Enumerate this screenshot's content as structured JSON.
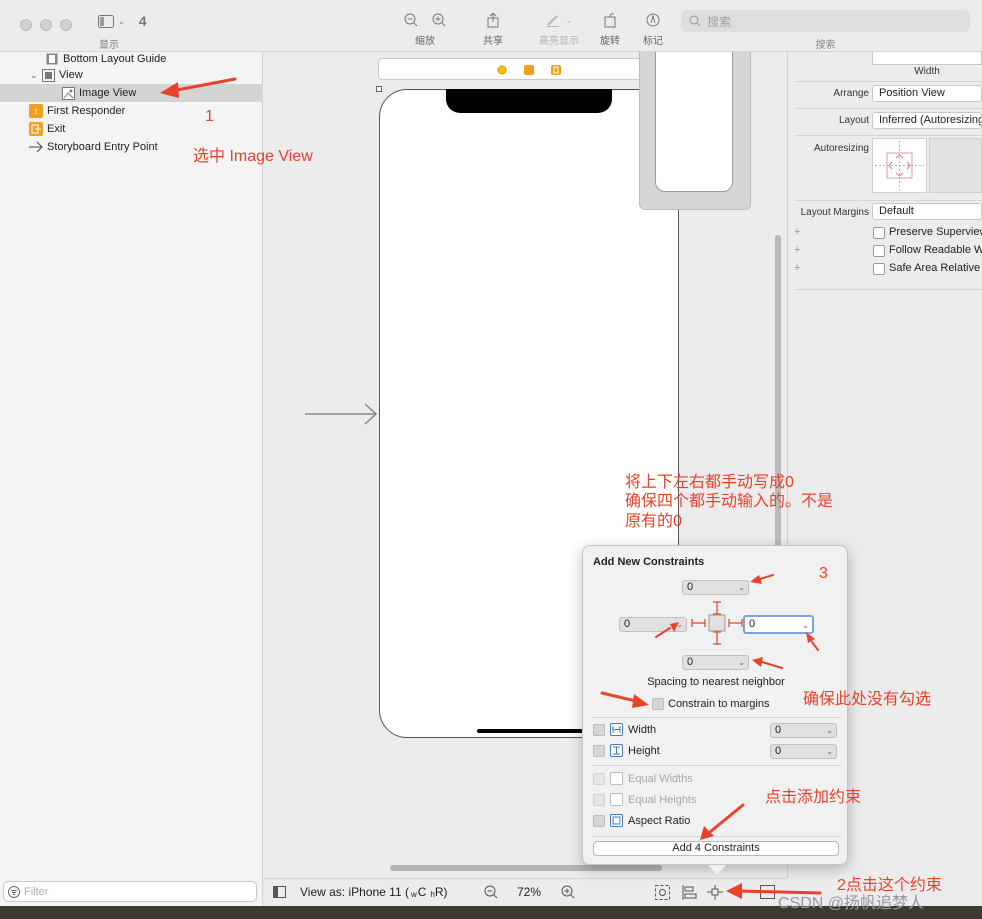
{
  "titlebar": {
    "view_count": "4",
    "show_label": "显示",
    "toolbar": [
      {
        "id": "zoom-out",
        "label": "缩放"
      },
      {
        "id": "share",
        "label": "共享"
      },
      {
        "id": "highlight",
        "label": "高亮显示"
      },
      {
        "id": "rotate",
        "label": "旋转"
      },
      {
        "id": "markup",
        "label": "标记"
      }
    ],
    "search_placeholder": "搜索",
    "search_label": "搜索"
  },
  "navigator": {
    "items": [
      {
        "label": "Bottom Layout Guide"
      },
      {
        "label": "View"
      },
      {
        "label": "Image View"
      },
      {
        "label": "First Responder"
      },
      {
        "label": "Exit"
      },
      {
        "label": "Storyboard Entry Point"
      }
    ],
    "filter_placeholder": "Filter"
  },
  "inspector": {
    "width_label": "Width",
    "arrange_label": "Arrange",
    "arrange_value": "Position View",
    "layout_label": "Layout",
    "layout_value": "Inferred (Autoresizing",
    "autoresizing_label": "Autoresizing",
    "layout_margins_label": "Layout Margins",
    "layout_margins_value": "Default",
    "checks": [
      "Preserve Superview",
      "Follow Readable W",
      "Safe Area Relative"
    ]
  },
  "popover": {
    "title": "Add New Constraints",
    "top_value": "0",
    "left_value": "0",
    "right_value": "0",
    "bottom_value": "0",
    "spacing_label": "Spacing to nearest neighbor",
    "constrain_margins_label": "Constrain to margins",
    "width_label": "Width",
    "width_value": "0",
    "height_label": "Height",
    "height_value": "0",
    "equal_widths_label": "Equal Widths",
    "equal_heights_label": "Equal Heights",
    "aspect_ratio_label": "Aspect Ratio",
    "add_button_label": "Add 4 Constraints"
  },
  "canvas_bar": {
    "view_as_label": "View as: iPhone 11 (",
    "view_as_w": "w",
    "view_as_c": "C",
    "view_as_h": "h",
    "view_as_r": "R)",
    "zoom_value": "72%"
  },
  "annotations": {
    "step1_number": "1",
    "step1_text": "选中 Image View",
    "note_line1": "将上下左右都手动写成0",
    "note_line2": "确保四个都手动输入的。不是",
    "note_line3": "原有的0",
    "step3_number": "3",
    "margins_note": "确保此处没有勾选",
    "add_note": "点击添加约束",
    "step2_text": "2点击这个约束",
    "watermark": "CSDN @扬帆追梦人",
    "color": "#e8422b"
  }
}
